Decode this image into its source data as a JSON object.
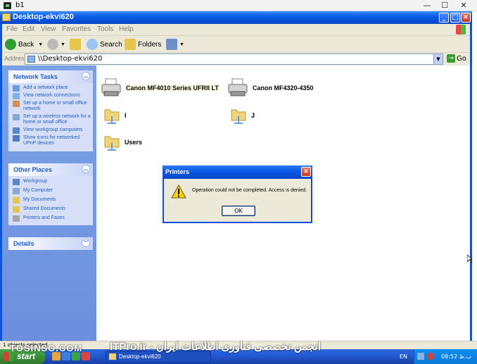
{
  "host": {
    "title": "b1",
    "minimize": "—",
    "maximize": "☐",
    "close": "✕"
  },
  "window": {
    "title": "Desktop-ekvi620",
    "menu": [
      "File",
      "Edit",
      "View",
      "Favorites",
      "Tools",
      "Help"
    ],
    "toolbar": {
      "back": "Back",
      "search": "Search",
      "folders": "Folders"
    },
    "address": {
      "label": "Address",
      "value": "\\\\Desktop-ekvi620",
      "go": "Go"
    }
  },
  "network_tasks": {
    "title": "Network Tasks",
    "items": [
      {
        "label": "Add a network place",
        "icon": "network-place-icon"
      },
      {
        "label": "View network connections",
        "icon": "network-connections-icon"
      },
      {
        "label": "Set up a home or small office network",
        "icon": "home-network-icon"
      },
      {
        "label": "Set up a wireless network for a home or small office",
        "icon": "wireless-icon"
      },
      {
        "label": "View workgroup computers",
        "icon": "workgroup-icon"
      },
      {
        "label": "Show icons for networked UPnP devices",
        "icon": "upnp-icon"
      }
    ]
  },
  "other_places": {
    "title": "Other Places",
    "items": [
      {
        "label": "Workgroup",
        "icon": "workgroup-icon"
      },
      {
        "label": "My Computer",
        "icon": "my-computer-icon"
      },
      {
        "label": "My Documents",
        "icon": "folder-icon"
      },
      {
        "label": "Shared Documents",
        "icon": "folder-icon"
      },
      {
        "label": "Printers and Faxes",
        "icon": "printer-icon"
      }
    ]
  },
  "details": {
    "title": "Details"
  },
  "items": [
    {
      "label": "Canon MF4010 Series UFRII LT",
      "type": "printer"
    },
    {
      "label": "Canon MF4320-4350",
      "type": "printer"
    },
    {
      "label": "I",
      "type": "shared-folder"
    },
    {
      "label": "J",
      "type": "shared-folder"
    },
    {
      "label": "Users",
      "type": "shared-folder"
    }
  ],
  "dialog": {
    "title": "Printers",
    "message": "Operation could not be completed. Access is denied.",
    "ok": "OK"
  },
  "status": "1 objects selected",
  "watermark": {
    "left": "TOSINSO.COM",
    "right": "انجمن تخصصی فناوری اطلاعات ایران - ITPro.ir"
  },
  "taskbar": {
    "start": "start",
    "task": "Desktop-ekvi620",
    "lang": "EN",
    "clock": "08:52 ب.ظ"
  },
  "colors": {
    "title_blue": "#0b5ce8",
    "task_link": "#215dc6",
    "start_green": "#3c8f3a"
  }
}
